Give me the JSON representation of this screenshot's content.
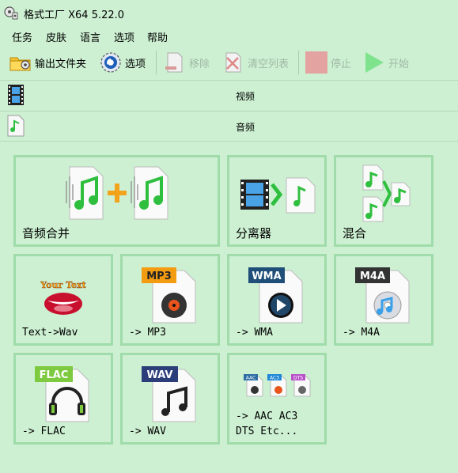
{
  "window": {
    "title": "格式工厂 X64 5.22.0"
  },
  "menu": {
    "items": [
      "任务",
      "皮肤",
      "语言",
      "选项",
      "帮助"
    ]
  },
  "toolbar": {
    "output_folder": "输出文件夹",
    "options": "选项",
    "remove": "移除",
    "clear_list": "清空列表",
    "stop": "停止",
    "start": "开始"
  },
  "categories": {
    "video": "视频",
    "audio": "音频"
  },
  "tiles": {
    "audio_merge": "音频合并",
    "splitter": "分离器",
    "mix": "混合",
    "text_to_wav": "Text->Wav",
    "to_mp3": "-> MP3",
    "to_wma": "-> WMA",
    "to_m4a": "-> M4A",
    "to_flac": "-> FLAC",
    "to_wav": "-> WAV",
    "to_aac_etc": "-> AAC AC3\nDTS Etc..."
  },
  "badges": {
    "mp3": "MP3",
    "wma": "WMA",
    "m4a": "M4A",
    "flac": "FLAC",
    "wav": "WAV",
    "your_text": "Your Text",
    "aac": "AAC",
    "ac3": "AC3",
    "dts": "DTS"
  },
  "colors": {
    "background": "#cdf0d2",
    "tile_border": "#9fdcaa",
    "music_green": "#2fbf3f",
    "plus_orange": "#f3a21b",
    "stop_red": "#e3a3a0",
    "start_green": "#7fe38e"
  },
  "icons": {
    "app": "format-factory-icon",
    "output_folder": "folder-icon",
    "options": "options-gear-icon",
    "remove": "remove-document-icon",
    "clear": "clear-list-icon",
    "stop": "stop-icon",
    "start": "play-icon"
  }
}
